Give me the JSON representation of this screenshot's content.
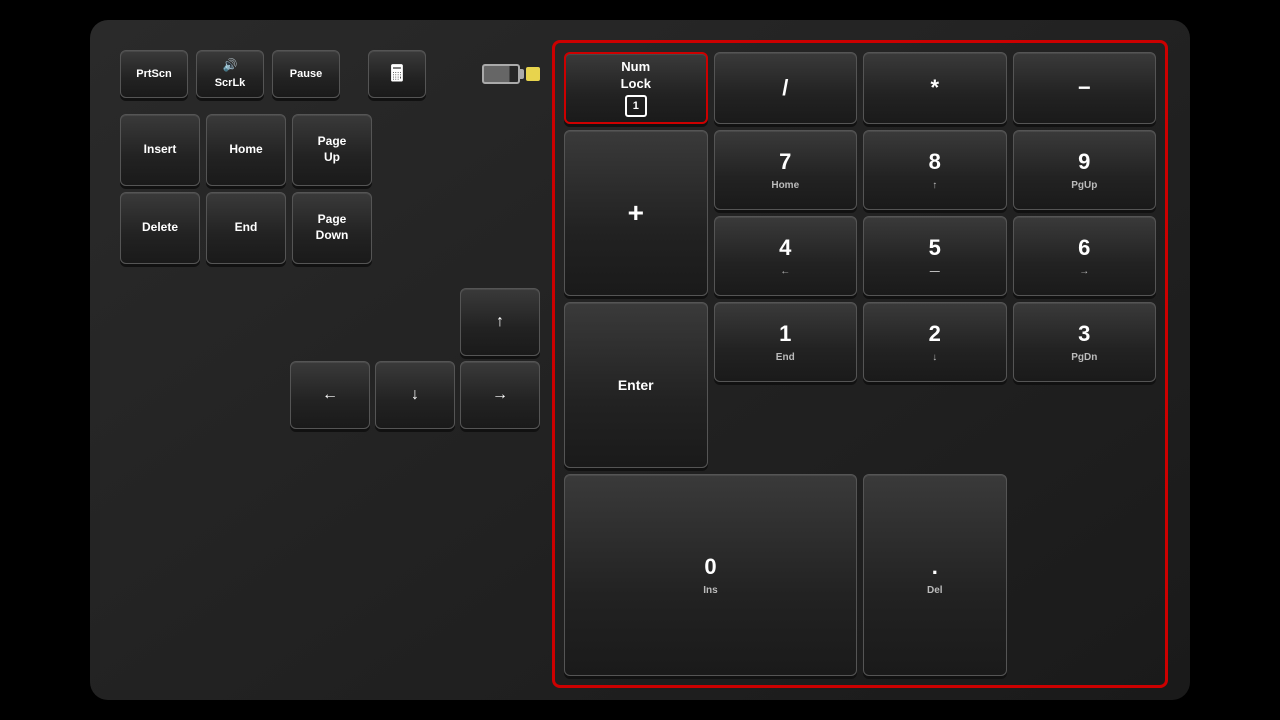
{
  "keyboard": {
    "top_keys": {
      "prtscn": "PrtScn",
      "scrlk": "ScrLk",
      "pause": "Pause",
      "calc_icon": "🖩"
    },
    "nav_keys": [
      {
        "label": "Insert",
        "sub": ""
      },
      {
        "label": "Home",
        "sub": ""
      },
      {
        "label": "Page\nUp",
        "sub": ""
      },
      {
        "label": "Delete",
        "sub": ""
      },
      {
        "label": "End",
        "sub": ""
      },
      {
        "label": "Page\nDown",
        "sub": ""
      }
    ],
    "arrow_keys": {
      "up": "↑",
      "left": "←",
      "down": "↓",
      "right": "→"
    },
    "numpad": {
      "numlock": {
        "main": "Num\nLock",
        "sub": "1"
      },
      "slash": "/",
      "asterisk": "*",
      "minus": "−",
      "seven": {
        "main": "7",
        "sub": "Home"
      },
      "eight": {
        "main": "8",
        "sub": "↑"
      },
      "nine": {
        "main": "9",
        "sub": "PgUp"
      },
      "plus": "+",
      "four": {
        "main": "4",
        "sub": "←"
      },
      "five": {
        "main": "5",
        "sub": "—"
      },
      "six": {
        "main": "6",
        "sub": "→"
      },
      "one": {
        "main": "1",
        "sub": "End"
      },
      "two": {
        "main": "2",
        "sub": "↓"
      },
      "three": {
        "main": "3",
        "sub": "PgDn"
      },
      "enter": "Enter",
      "zero": {
        "main": "0",
        "sub": "Ins"
      },
      "dot": {
        "main": ".",
        "sub": "Del"
      }
    }
  }
}
